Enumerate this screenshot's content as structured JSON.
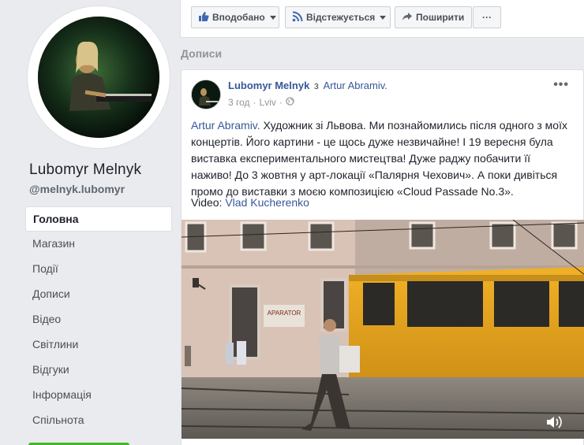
{
  "page": {
    "name": "Lubomyr Melnyk",
    "handle": "@melnyk.lubomyr"
  },
  "nav": {
    "items": [
      {
        "label": "Головна",
        "active": true
      },
      {
        "label": "Магазин"
      },
      {
        "label": "Події"
      },
      {
        "label": "Дописи"
      },
      {
        "label": "Відео"
      },
      {
        "label": "Світлини"
      },
      {
        "label": "Відгуки"
      },
      {
        "label": "Інформація"
      },
      {
        "label": "Спільнота"
      }
    ]
  },
  "actions": {
    "like": "Вподобано",
    "follow": "Відстежується",
    "share": "Поширити",
    "more": "···"
  },
  "section_title": "Дописи",
  "post": {
    "author": "Lubomyr Melnyk",
    "with_word": "з",
    "tagged": "Artur Abramiv.",
    "time": "3 год",
    "location": "Lviv",
    "more": "•••",
    "text_mention": "Artur Abramiv.",
    "text_body": " Художник зі Львова. Ми познайомились після одного з моїх концертів. Його картини - це щось дуже незвичайне! І 19 вересня була виставка експериментального мистецтва! Дуже раджу побачити її наживо! До 3 жовтня у арт-локації «Палярня Чехович». А поки дивіться промо до виставки з моєю композицією «Cloud Passade No.3».",
    "video_label": "Video:",
    "video_author": "Vlad Kucherenko",
    "sign_text": "APARATOR"
  },
  "colors": {
    "link": "#365899",
    "background": "#e9ebee",
    "tram": "#e6a51a",
    "accent_green": "#42b72a"
  },
  "icons": [
    "thumbs-up-icon",
    "rss-icon",
    "share-arrow-icon",
    "globe-icon",
    "volume-icon",
    "more-dots-icon"
  ]
}
